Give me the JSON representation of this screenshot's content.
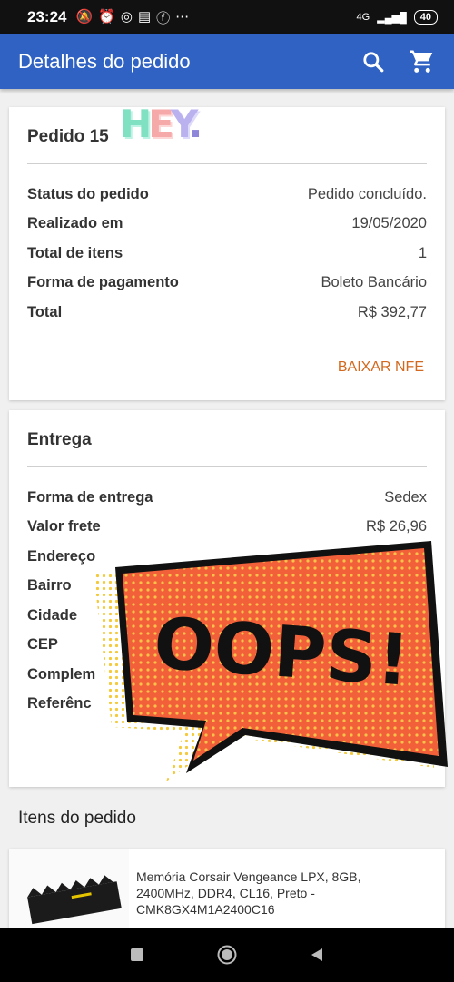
{
  "status_bar": {
    "time": "23:24",
    "icons": [
      "notifications-off-icon",
      "alarm-icon",
      "whatsapp-icon",
      "news-icon",
      "facebook-icon",
      "more-icon"
    ],
    "network": "4G",
    "battery": "40"
  },
  "app_bar": {
    "title": "Detalhes do pedido",
    "actions": [
      "search-icon",
      "cart-icon"
    ]
  },
  "order": {
    "title": "Pedido 15",
    "sticker_text": "HEY.",
    "rows": [
      {
        "label": "Status do pedido",
        "value": "Pedido concluído."
      },
      {
        "label": "Realizado em",
        "value": "19/05/2020"
      },
      {
        "label": "Total de itens",
        "value": "1"
      },
      {
        "label": "Forma de pagamento",
        "value": "Boleto Bancário"
      },
      {
        "label": "Total",
        "value": "R$ 392,77"
      }
    ],
    "nfe_link": "BAIXAR NFE"
  },
  "delivery": {
    "title": "Entrega",
    "rows": [
      {
        "label": "Forma de entrega",
        "value": "Sedex"
      },
      {
        "label": "Valor frete",
        "value": "R$ 26,96"
      },
      {
        "label": "Endereço",
        "value": ""
      },
      {
        "label": "Bairro",
        "value": ""
      },
      {
        "label": "Cidade",
        "value": ""
      },
      {
        "label": "CEP",
        "value": ""
      },
      {
        "label": "Complem",
        "value": ""
      },
      {
        "label": "Referênc",
        "value": ""
      }
    ]
  },
  "sticker_oops": "OOPS!",
  "items": {
    "title": "Itens do pedido",
    "list": [
      {
        "name": "Memória Corsair Vengeance LPX, 8GB, 2400MHz, DDR4, CL16, Preto - CMK8GX4M1A2400C16"
      }
    ]
  },
  "colors": {
    "app_bar": "#2f62c2",
    "link": "#d2691e",
    "oops_orange": "#f2603a"
  }
}
